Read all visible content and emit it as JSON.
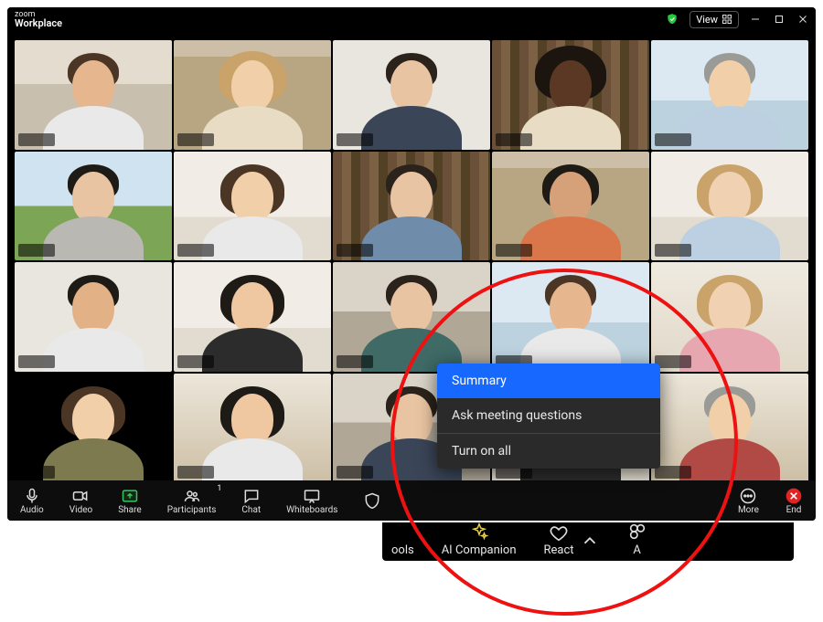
{
  "titlebar": {
    "brand_upper": "zoom",
    "brand_lower": "Workplace",
    "view_label": "View"
  },
  "toolbar": {
    "audio_label": "Audio",
    "video_label": "Video",
    "share_label": "Share",
    "participants_label": "Participants",
    "participants_count": "1",
    "chat_label": "Chat",
    "whiteboards_label": "Whiteboards",
    "more_label": "More",
    "end_label": "End"
  },
  "overflow": {
    "tools_label": "ools",
    "ai_companion_label": "AI Companion",
    "react_label": "React",
    "apps_stub": "A"
  },
  "popup": {
    "summary": "Summary",
    "ask": "Ask meeting questions",
    "turn_on_all": "Turn on all"
  }
}
